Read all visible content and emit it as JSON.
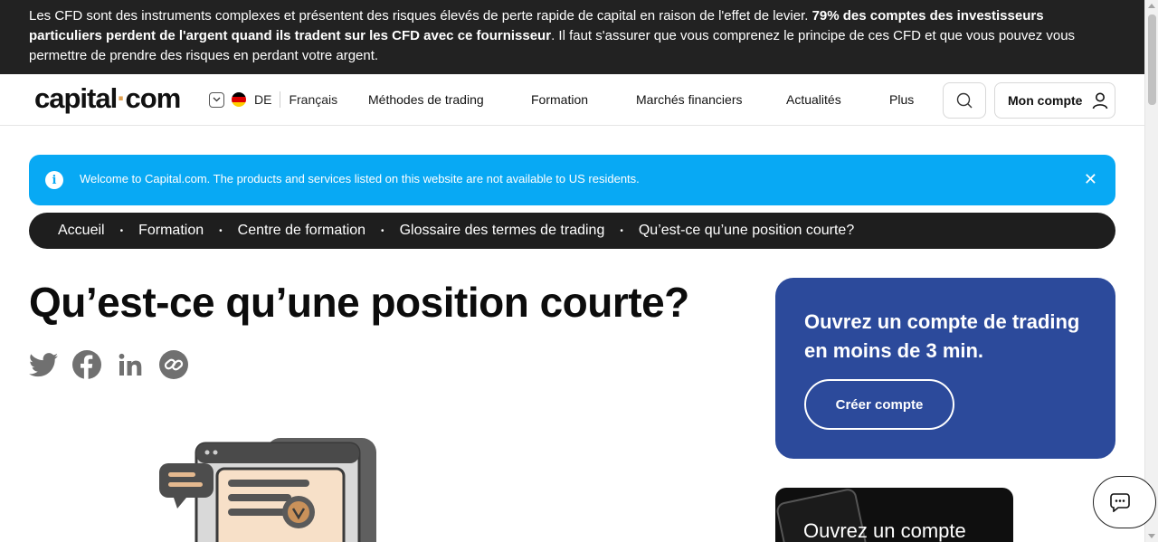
{
  "risk_banner": {
    "text_1": "Les CFD sont des instruments complexes et présentent des risques élevés de perte rapide de capital en raison de l'effet de levier. ",
    "bold": "79% des comptes des investisseurs particuliers perdent de l'argent quand ils tradent sur les CFD avec ce fournisseur",
    "text_2": ". Il faut s'assurer que vous comprenez le principe de ces CFD et que vous pouvez vous permettre de prendre des risques en perdant votre argent."
  },
  "header": {
    "logo_left": "capital",
    "logo_dot": "·",
    "logo_right": "com",
    "country_code": "DE",
    "language": "Français",
    "nav": [
      "Méthodes de trading",
      "Formation",
      "Marchés financiers",
      "Actualités",
      "Plus"
    ],
    "account_label": "Mon compte",
    "icons": [
      "chevron-down-icon",
      "search-icon",
      "user-icon"
    ]
  },
  "notice": {
    "text": "Welcome to Capital.com. The products and services listed on this website are not available to US residents.",
    "info_glyph": "i",
    "close_glyph": "✕",
    "color": "#08a9f4"
  },
  "breadcrumb": {
    "items": [
      "Accueil",
      "Formation",
      "Centre de formation",
      "Glossaire des termes de trading",
      "Qu’est-ce qu’une position courte?"
    ],
    "separator": "•"
  },
  "article": {
    "title": "Qu’est-ce qu’une position courte?",
    "share_icons": [
      "twitter-icon",
      "facebook-icon",
      "linkedin-icon",
      "copy-link-icon"
    ]
  },
  "cta": {
    "heading": "Ouvrez un compte de trading en moins de 3 min.",
    "button": "Créer compte",
    "color": "#2c4a9b"
  },
  "promo": {
    "label": "Ouvrez un compte"
  },
  "colors": {
    "banner_bg": "#222222",
    "breadcrumb_bg": "#1e1e1e",
    "logo_accent": "#e0a050"
  }
}
